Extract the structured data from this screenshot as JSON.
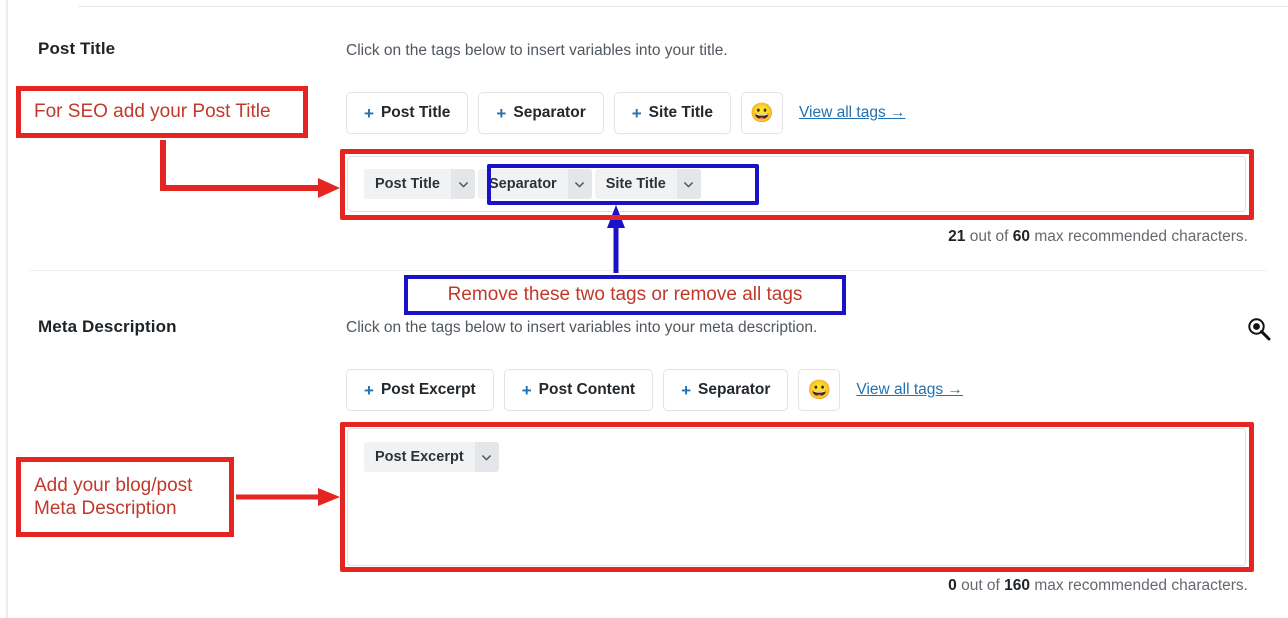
{
  "sections": {
    "post_title": {
      "label": "Post Title",
      "helper": "Click on the tags below to insert variables into your title.",
      "tag_buttons": [
        {
          "plus": "+",
          "label": "Post Title"
        },
        {
          "plus": "+",
          "label": "Separator"
        },
        {
          "plus": "+",
          "label": "Site Title"
        }
      ],
      "emoji": "😀",
      "view_all": "View all tags →",
      "chips": [
        {
          "label": "Post Title"
        },
        {
          "label": "Separator"
        },
        {
          "label": "Site Title"
        }
      ],
      "counter": {
        "count": "21",
        "mid": " out of ",
        "max": "60",
        "suffix": " max recommended characters."
      }
    },
    "meta_description": {
      "label": "Meta Description",
      "helper": "Click on the tags below to insert variables into your meta description.",
      "tag_buttons": [
        {
          "plus": "+",
          "label": "Post Excerpt"
        },
        {
          "plus": "+",
          "label": "Post Content"
        },
        {
          "plus": "+",
          "label": "Separator"
        }
      ],
      "emoji": "😀",
      "view_all": "View all tags →",
      "chips": [
        {
          "label": "Post Excerpt"
        }
      ],
      "counter": {
        "count": "0",
        "mid": " out of ",
        "max": "160",
        "suffix": " max recommended characters."
      }
    }
  },
  "annotations": {
    "seo_title": "For SEO add your Post Title",
    "remove_tags": "Remove these two tags or remove all tags",
    "meta_line1": "Add your blog/post",
    "meta_line2": "Meta Description"
  },
  "colors": {
    "annotation_red": "#e52521",
    "annotation_text_red": "#c0392b",
    "annotation_blue": "#1a12c9",
    "link_blue": "#2271b1",
    "chip_bg": "#f1f2f4",
    "chip_caret_bg": "#e4e6e9"
  },
  "icons": {
    "magnifier": "zoom-in-icon",
    "caret": "chevron-down-icon"
  }
}
